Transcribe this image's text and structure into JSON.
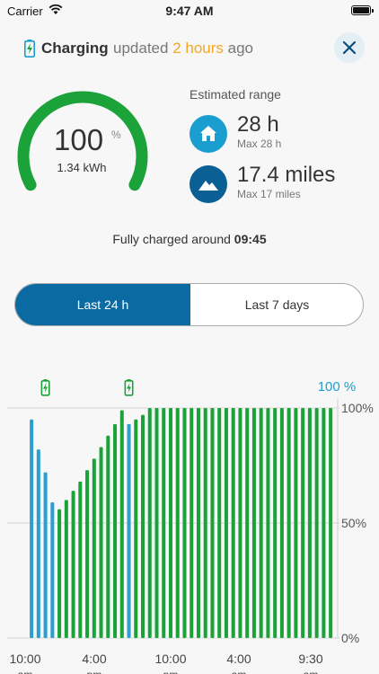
{
  "status_bar": {
    "carrier": "Carrier",
    "time": "9:47 AM"
  },
  "header": {
    "status_label": "Charging",
    "updated_prefix": "updated",
    "updated_time": "2 hours",
    "updated_suffix": "ago"
  },
  "gauge": {
    "percent": "100",
    "unit": "%",
    "energy": "1.34 kWh",
    "level": 1.0
  },
  "range": {
    "title": "Estimated range",
    "items": [
      {
        "icon": "home-icon",
        "value": "28 h",
        "max": "Max 28 h"
      },
      {
        "icon": "mountain-icon",
        "value": "17.4 miles",
        "max": "Max 17 miles"
      }
    ]
  },
  "fully_charged": {
    "prefix": "Fully charged around",
    "time": "09:45"
  },
  "tabs": [
    {
      "label": "Last 24 h",
      "selected": true
    },
    {
      "label": "Last 7 days",
      "selected": false
    }
  ],
  "colors": {
    "charging": "#1ba33a",
    "discharging": "#2a9fd0",
    "accent": "#0a6aa1",
    "orange": "#f5a623"
  },
  "chart_data": {
    "type": "bar",
    "top_label": "100 %",
    "y_ticks": [
      "100%",
      "50%",
      "0%"
    ],
    "ylim": [
      0,
      100
    ],
    "x_ticks": [
      {
        "time": "10:00",
        "ampm": "am"
      },
      {
        "time": "4:00",
        "ampm": "pm"
      },
      {
        "time": "10:00",
        "ampm": "pm"
      },
      {
        "time": "4:00",
        "ampm": "am"
      },
      {
        "time": "9:30",
        "ampm": "am"
      }
    ],
    "charge_markers": [
      5,
      17
    ],
    "bars": [
      {
        "v": 0,
        "s": "d"
      },
      {
        "v": 0,
        "s": "d"
      },
      {
        "v": 0,
        "s": "d"
      },
      {
        "v": 95,
        "s": "d"
      },
      {
        "v": 82,
        "s": "d"
      },
      {
        "v": 72,
        "s": "d"
      },
      {
        "v": 59,
        "s": "d"
      },
      {
        "v": 56,
        "s": "c"
      },
      {
        "v": 60,
        "s": "c"
      },
      {
        "v": 64,
        "s": "c"
      },
      {
        "v": 68,
        "s": "c"
      },
      {
        "v": 73,
        "s": "c"
      },
      {
        "v": 78,
        "s": "c"
      },
      {
        "v": 83,
        "s": "c"
      },
      {
        "v": 88,
        "s": "c"
      },
      {
        "v": 93,
        "s": "c"
      },
      {
        "v": 99,
        "s": "c"
      },
      {
        "v": 93,
        "s": "d"
      },
      {
        "v": 95,
        "s": "c"
      },
      {
        "v": 97,
        "s": "c"
      },
      {
        "v": 100,
        "s": "c"
      },
      {
        "v": 100,
        "s": "c"
      },
      {
        "v": 100,
        "s": "c"
      },
      {
        "v": 100,
        "s": "c"
      },
      {
        "v": 100,
        "s": "c"
      },
      {
        "v": 100,
        "s": "c"
      },
      {
        "v": 100,
        "s": "c"
      },
      {
        "v": 100,
        "s": "c"
      },
      {
        "v": 100,
        "s": "c"
      },
      {
        "v": 100,
        "s": "c"
      },
      {
        "v": 100,
        "s": "c"
      },
      {
        "v": 100,
        "s": "c"
      },
      {
        "v": 100,
        "s": "c"
      },
      {
        "v": 100,
        "s": "c"
      },
      {
        "v": 100,
        "s": "c"
      },
      {
        "v": 100,
        "s": "c"
      },
      {
        "v": 100,
        "s": "c"
      },
      {
        "v": 100,
        "s": "c"
      },
      {
        "v": 100,
        "s": "c"
      },
      {
        "v": 100,
        "s": "c"
      },
      {
        "v": 100,
        "s": "c"
      },
      {
        "v": 100,
        "s": "c"
      },
      {
        "v": 100,
        "s": "c"
      },
      {
        "v": 100,
        "s": "c"
      },
      {
        "v": 100,
        "s": "c"
      },
      {
        "v": 100,
        "s": "c"
      },
      {
        "v": 100,
        "s": "c"
      }
    ]
  }
}
